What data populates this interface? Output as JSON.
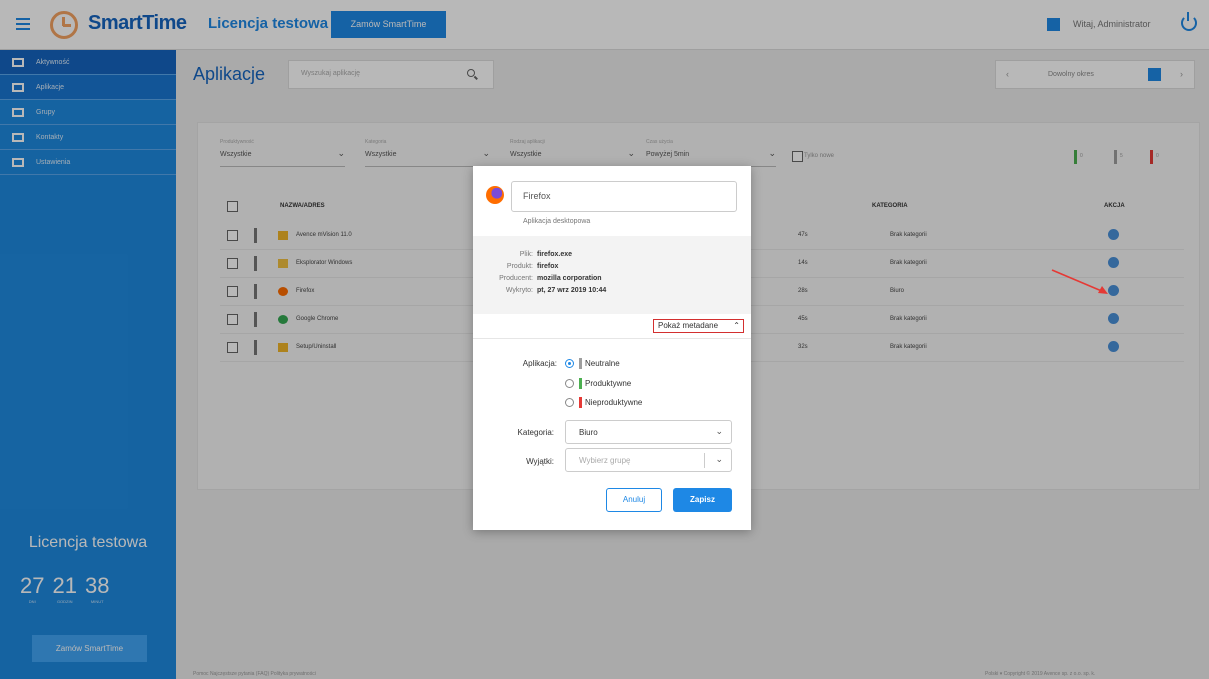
{
  "topbar": {
    "logo": "SmartTime",
    "license_title": "Licencja testowa",
    "order_button": "Zamów SmartTime",
    "welcome": "Witaj, Administrator"
  },
  "sidebar": {
    "items": [
      {
        "label": "Aktywność"
      },
      {
        "label": "Aplikacje"
      },
      {
        "label": "Grupy"
      },
      {
        "label": "Kontakty"
      },
      {
        "label": "Ustawienia"
      }
    ],
    "license_title": "Licencja testowa",
    "timer": [
      {
        "value": "27",
        "unit": "DNI"
      },
      {
        "value": "21",
        "unit": "GODZIN"
      },
      {
        "value": "38",
        "unit": "MINUT"
      }
    ],
    "order_button": "Zamów SmartTime"
  },
  "page": {
    "title": "Aplikacje",
    "search_placeholder": "Wyszukaj aplikację",
    "period_label": "Dowolny okres"
  },
  "filters": [
    {
      "label": "Produktywność",
      "value": "Wszystkie"
    },
    {
      "label": "Kategoria",
      "value": "Wszystkie"
    },
    {
      "label": "Rodzaj aplikacji",
      "value": "Wszystkie"
    },
    {
      "label": "Czas użycia",
      "value": "Powyżej 5min"
    }
  ],
  "only_new_label": "Tylko nowe",
  "legend": [
    {
      "count": "0",
      "color": "#4caf50"
    },
    {
      "count": "5",
      "color": "#9e9e9e"
    },
    {
      "count": "0",
      "color": "#e53935"
    }
  ],
  "table": {
    "headers": {
      "name": "NAZWA/ADRES",
      "category": "KATEGORIA",
      "action": "AKCJA"
    },
    "rows": [
      {
        "name": "Avence mVision 11.0",
        "time": "47s",
        "category": "Brak kategorii",
        "icon_color": "#f0b429"
      },
      {
        "name": "Eksplorator Windows",
        "time": "14s",
        "category": "Brak kategorii",
        "icon_color": "#f0c040"
      },
      {
        "name": "Firefox",
        "time": "28s",
        "category": "Biuro",
        "icon_color": "#ff6d00"
      },
      {
        "name": "Google Chrome",
        "time": "45s",
        "category": "Brak kategorii",
        "icon_color": "#34a853"
      },
      {
        "name": "Setup/Uninstall",
        "time": "32s",
        "category": "Brak kategorii",
        "icon_color": "#f0b429"
      }
    ]
  },
  "footer": {
    "left": "Pomoc    Najczęstsze pytania (FAQ)    Polityka prywatności",
    "right": "Polski ▾    Copyright © 2019 Avence sp. z o.o. sp. k."
  },
  "modal": {
    "app_name": "Firefox",
    "app_type": "Aplikacja desktopowa",
    "info": [
      {
        "key": "Plik:",
        "value": "firefox.exe"
      },
      {
        "key": "Produkt:",
        "value": "firefox"
      },
      {
        "key": "Producent:",
        "value": "mozilla corporation"
      },
      {
        "key": "Wykryto:",
        "value": "pt, 27 wrz 2019 10:44"
      }
    ],
    "metadata_toggle": "Pokaż metadane",
    "application_label": "Aplikacja:",
    "options": [
      {
        "label": "Neutralne",
        "color": "#9e9e9e",
        "selected": true
      },
      {
        "label": "Produktywne",
        "color": "#4caf50",
        "selected": false
      },
      {
        "label": "Nieproduktywne",
        "color": "#e53935",
        "selected": false
      }
    ],
    "category_label": "Kategoria:",
    "category_value": "Biuro",
    "exceptions_label": "Wyjątki:",
    "exceptions_placeholder": "Wybierz grupę",
    "cancel": "Anuluj",
    "save": "Zapisz"
  }
}
